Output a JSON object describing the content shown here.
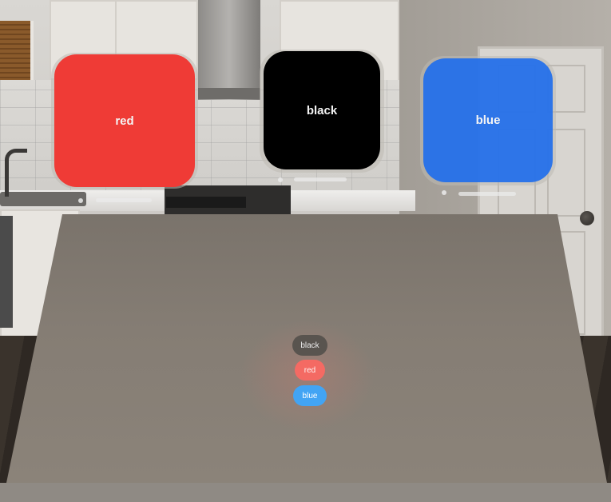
{
  "windows": [
    {
      "id": "red",
      "label": "red",
      "color": "#ef3b36"
    },
    {
      "id": "black",
      "label": "black",
      "color": "#000000"
    },
    {
      "id": "blue",
      "label": "blue",
      "color": "#216eeb"
    }
  ],
  "buttons": {
    "black_label": "black",
    "red_label": "red",
    "blue_label": "blue",
    "black_color": "#59544f",
    "red_color": "#f46a63",
    "blue_color": "#42a4f4"
  }
}
